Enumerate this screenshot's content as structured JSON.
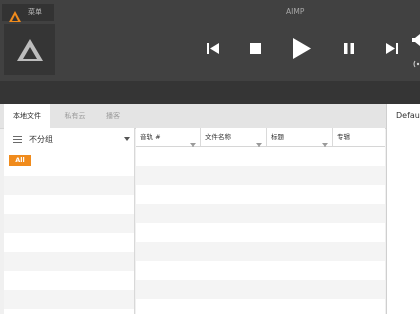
{
  "app": {
    "title": "AIMP",
    "menu_label": "菜单",
    "accent_color": "#f08b1c"
  },
  "player": {
    "controls": [
      "previous-icon",
      "stop-icon",
      "play-icon",
      "pause-icon",
      "next-icon",
      "volume-icon"
    ]
  },
  "tabs": [
    {
      "label": "本地文件",
      "active": true
    },
    {
      "label": "私有云",
      "active": false
    },
    {
      "label": "播客",
      "active": false
    }
  ],
  "right_panel": {
    "label": "Defaul"
  },
  "groups": {
    "label": "不分组",
    "all_badge": "All"
  },
  "columns": [
    {
      "label": "音轨 #"
    },
    {
      "label": "文件名称"
    },
    {
      "label": "标题"
    },
    {
      "label": "专辑"
    }
  ]
}
